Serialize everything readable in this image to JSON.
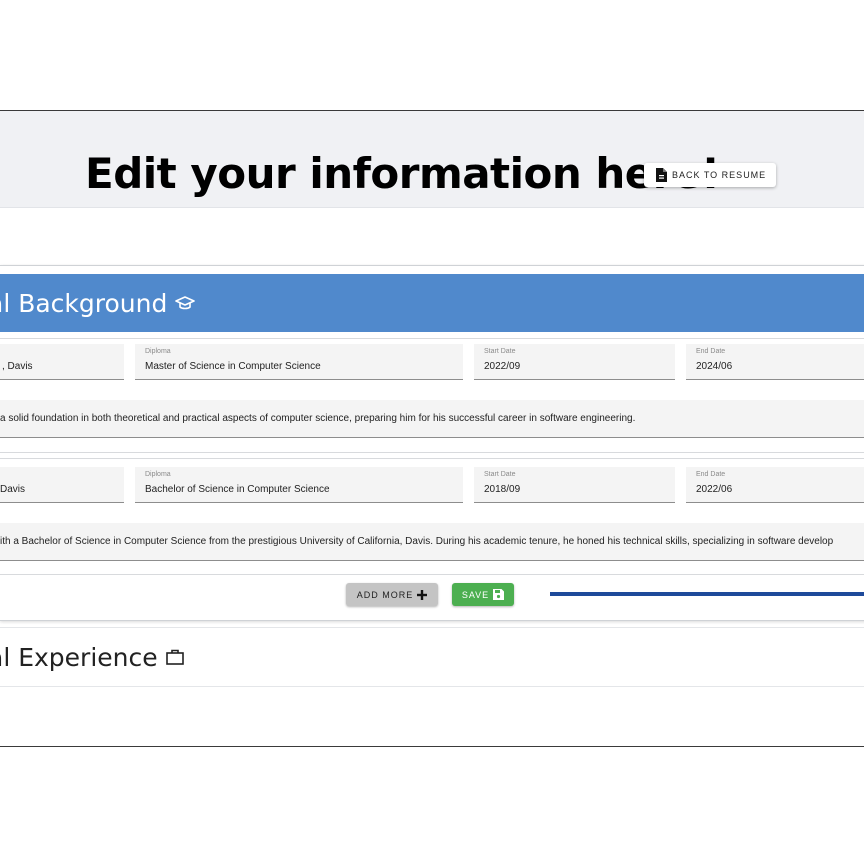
{
  "header": {
    "title": "Edit your information here!",
    "back_label": "BACK TO RESUME"
  },
  "education": {
    "title": "al Background",
    "entries": [
      {
        "institution": ", Davis",
        "diploma_label": "Diploma",
        "diploma": "Master of Science in Computer Science",
        "start_label": "Start Date",
        "start": "2022/09",
        "end_label": "End Date",
        "end": "2024/06",
        "description": "a solid foundation in both theoretical and practical aspects of computer science, preparing him for his successful career in software engineering."
      },
      {
        "institution": " Davis",
        "diploma_label": "Diploma",
        "diploma": "Bachelor of Science in Computer Science",
        "start_label": "Start Date",
        "start": "2018/09",
        "end_label": "End Date",
        "end": "2022/06",
        "description": "ith a Bachelor of Science in Computer Science from the prestigious University of California, Davis. During his academic tenure, he honed his technical skills, specializing in software develop"
      }
    ],
    "add_label": "ADD MORE",
    "save_label": "SAVE"
  },
  "experience": {
    "title": "al Experience"
  },
  "colors": {
    "header_bg": "#f0f1f4",
    "panel_accent": "#5089cc",
    "save_green": "#4caf50",
    "add_gray": "#c4c4c4",
    "annotation_line": "#1e4a9a"
  },
  "icons": [
    "file-icon",
    "graduation-cap-icon",
    "plus-icon",
    "floppy-disk-icon",
    "briefcase-icon"
  ]
}
